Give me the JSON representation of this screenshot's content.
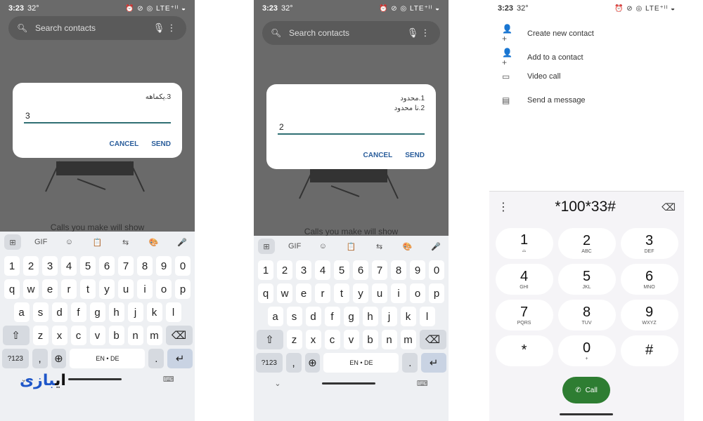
{
  "status": {
    "time": "3:23",
    "temp": "32°",
    "indicators": "⏰ ⊘ ◎ LTE⁺ᴵᴵ ◒"
  },
  "search_placeholder": "Search contacts",
  "p1": {
    "message": "3.یکماهه",
    "input": "3",
    "cancel": "CANCEL",
    "send": "SEND"
  },
  "p2": {
    "message1": "1.محدود",
    "message2": "2.نا محدود",
    "input": "2",
    "cancel": "CANCEL",
    "send": "SEND"
  },
  "hint": "Calls you make will show",
  "keyboard": {
    "suggest": [
      "⊞",
      "GIF",
      "☺",
      "📋",
      "⇆",
      "🎨",
      "🎤"
    ],
    "digits": [
      "1",
      "2",
      "3",
      "4",
      "5",
      "6",
      "7",
      "8",
      "9",
      "0"
    ],
    "row1": [
      "q",
      "w",
      "e",
      "r",
      "t",
      "y",
      "u",
      "i",
      "o",
      "p"
    ],
    "row2": [
      "a",
      "s",
      "d",
      "f",
      "g",
      "h",
      "j",
      "k",
      "l"
    ],
    "row3": [
      "z",
      "x",
      "c",
      "v",
      "b",
      "n",
      "m"
    ],
    "sym": "?123",
    "comma": ",",
    "space": "EN • DE",
    "period": ".",
    "shift": "⇧",
    "back": "⌫",
    "enter": "↵",
    "globe": "⊕",
    "nav_back": "⌄",
    "nav_kbd": "⌨"
  },
  "menu": [
    {
      "icon": "person-add-icon",
      "glyph": "👤+",
      "label": "Create new contact"
    },
    {
      "icon": "person-add-icon",
      "glyph": "👤+",
      "label": "Add to a contact"
    },
    {
      "icon": "video-icon",
      "glyph": "▭",
      "label": "Video call"
    },
    {
      "icon": "message-icon",
      "glyph": "▤",
      "label": "Send a message"
    }
  ],
  "dialer": {
    "number": "*100*33#",
    "more": "⋮",
    "backspace": "⌫",
    "keys": [
      {
        "d": "1",
        "l": "⌓"
      },
      {
        "d": "2",
        "l": "ABC"
      },
      {
        "d": "3",
        "l": "DEF"
      },
      {
        "d": "4",
        "l": "GHI"
      },
      {
        "d": "5",
        "l": "JKL"
      },
      {
        "d": "6",
        "l": "MNO"
      },
      {
        "d": "7",
        "l": "PQRS"
      },
      {
        "d": "8",
        "l": "TUV"
      },
      {
        "d": "9",
        "l": "WXYZ"
      },
      {
        "d": "*",
        "l": ""
      },
      {
        "d": "0",
        "l": "+"
      },
      {
        "d": "#",
        "l": ""
      }
    ],
    "call": "Call"
  },
  "watermark": {
    "part1": "ای",
    "part2": "بازی"
  }
}
